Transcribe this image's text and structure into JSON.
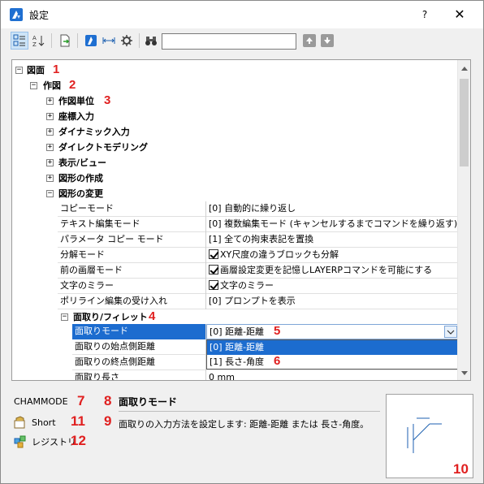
{
  "window": {
    "title": "設定",
    "help_label": "?",
    "close_label": "✕"
  },
  "toolbar": {
    "search_value": "",
    "search_placeholder": ""
  },
  "tree": {
    "root": {
      "label": "図面",
      "marker": "1"
    },
    "draft": {
      "label": "作図",
      "marker": "2"
    },
    "categories": [
      {
        "label": "作図単位",
        "marker": "3"
      },
      {
        "label": "座標入力",
        "marker": ""
      },
      {
        "label": "ダイナミック入力",
        "marker": ""
      },
      {
        "label": "ダイレクトモデリング",
        "marker": ""
      },
      {
        "label": "表示/ビュー",
        "marker": ""
      },
      {
        "label": "図形の作成",
        "marker": ""
      },
      {
        "label": "図形の変更",
        "marker": ""
      }
    ],
    "properties": [
      {
        "name": "コピーモード",
        "value": "[0] 自動的に繰り返し",
        "checkbox": false
      },
      {
        "name": "テキスト編集モード",
        "value": "[0] 複数編集モード (キャンセルするまでコマンドを繰り返す)",
        "checkbox": false
      },
      {
        "name": "パラメータ コピー モード",
        "value": "[1] 全ての拘束表記を置換",
        "checkbox": false
      },
      {
        "name": "分解モード",
        "value": "XY尺度の違うブロックも分解",
        "checkbox": true
      },
      {
        "name": "前の画層モード",
        "value": "画層設定変更を記憶しLAYERPコマンドを可能にする",
        "checkbox": true
      },
      {
        "name": "文字のミラー",
        "value": "文字のミラー",
        "checkbox": true
      },
      {
        "name": "ポリライン編集の受け入れ",
        "value": "[0] プロンプトを表示",
        "checkbox": false
      }
    ],
    "chamfer_group": {
      "label": "面取り/フィレット",
      "marker": "4"
    },
    "chamfer_props": [
      {
        "name": "面取りモード",
        "value": "[0] 距離-距離",
        "marker": "5"
      },
      {
        "name": "面取りの始点側距離",
        "value": ""
      },
      {
        "name": "面取りの終点側距離",
        "value": ""
      },
      {
        "name": "面取り長さ",
        "value": "0 mm"
      }
    ],
    "dropdown_options": [
      {
        "label": "[0] 距離-距離",
        "selected": true,
        "marker": ""
      },
      {
        "label": "[1] 長さ-角度",
        "selected": false,
        "marker": "6"
      }
    ]
  },
  "info": {
    "command": "CHAMMODE",
    "command_marker": "7",
    "title_marker": "8",
    "title": "面取りモード",
    "desc_marker": "9",
    "description": "面取りの入力方法を設定します: 距離-距離 または 長さ-角度。",
    "scope_label": "Short",
    "scope_marker": "11",
    "storage_label": "レジストリ",
    "storage_marker": "12",
    "preview_marker": "10"
  },
  "colors": {
    "accent": "#1c6ccf",
    "marker": "#e02020"
  }
}
